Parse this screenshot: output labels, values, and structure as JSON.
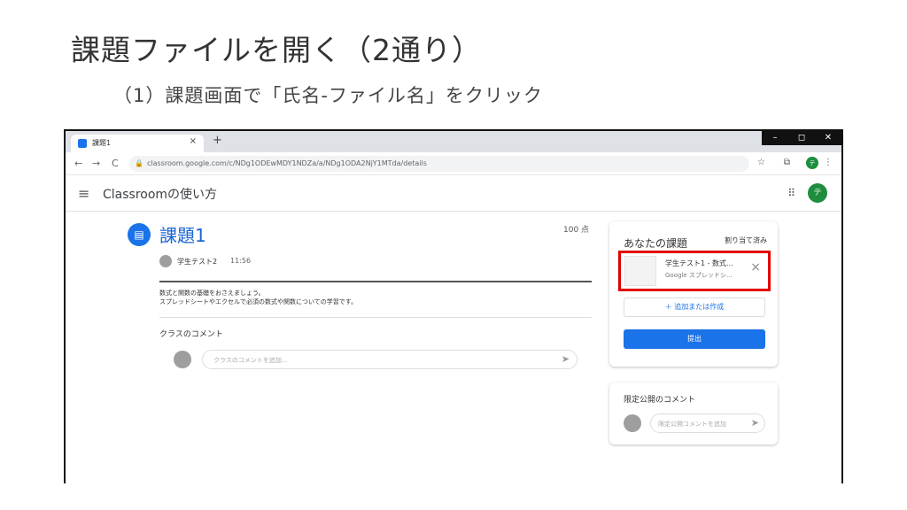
{
  "slide": {
    "title": "課題ファイルを開く（2通り）",
    "subtitle": "（1）課題画面で「氏名-ファイル名」をクリック"
  },
  "browser": {
    "tab_title": "課題1",
    "tab_close": "×",
    "new_tab": "+",
    "window_controls": [
      "–",
      "◻",
      "✕"
    ],
    "nav_back": "←",
    "nav_forward": "→",
    "nav_reload": "C",
    "url": "classroom.google.com/c/NDg1ODEwMDY1NDZa/a/NDg1ODA2NjY1MTda/details",
    "avatar_letter": "テ"
  },
  "classroom": {
    "title": "Classroomの使い方",
    "avatar_letter": "テ"
  },
  "assignment": {
    "title": "課題1",
    "points": "100 点",
    "author": "学生テスト2",
    "time": "11:56",
    "description_line1": "数式と関数の基礎をおさえましょう。",
    "description_line2": "スプレッドシートやエクセルで必須の数式や関数についての学習です。",
    "class_comments_label": "クラスのコメント",
    "comment_placeholder": "クラスのコメントを追加..."
  },
  "your_work": {
    "title": "あなたの課題",
    "status": "割り当て済み",
    "file_name": "学生テスト1 - 数式...",
    "file_type": "Google スプレッドシ...",
    "add_button": "＋ 追加または作成",
    "submit_button": "提出"
  },
  "private_comments": {
    "title": "限定公開のコメント",
    "placeholder": "限定公開コメントを追加"
  }
}
